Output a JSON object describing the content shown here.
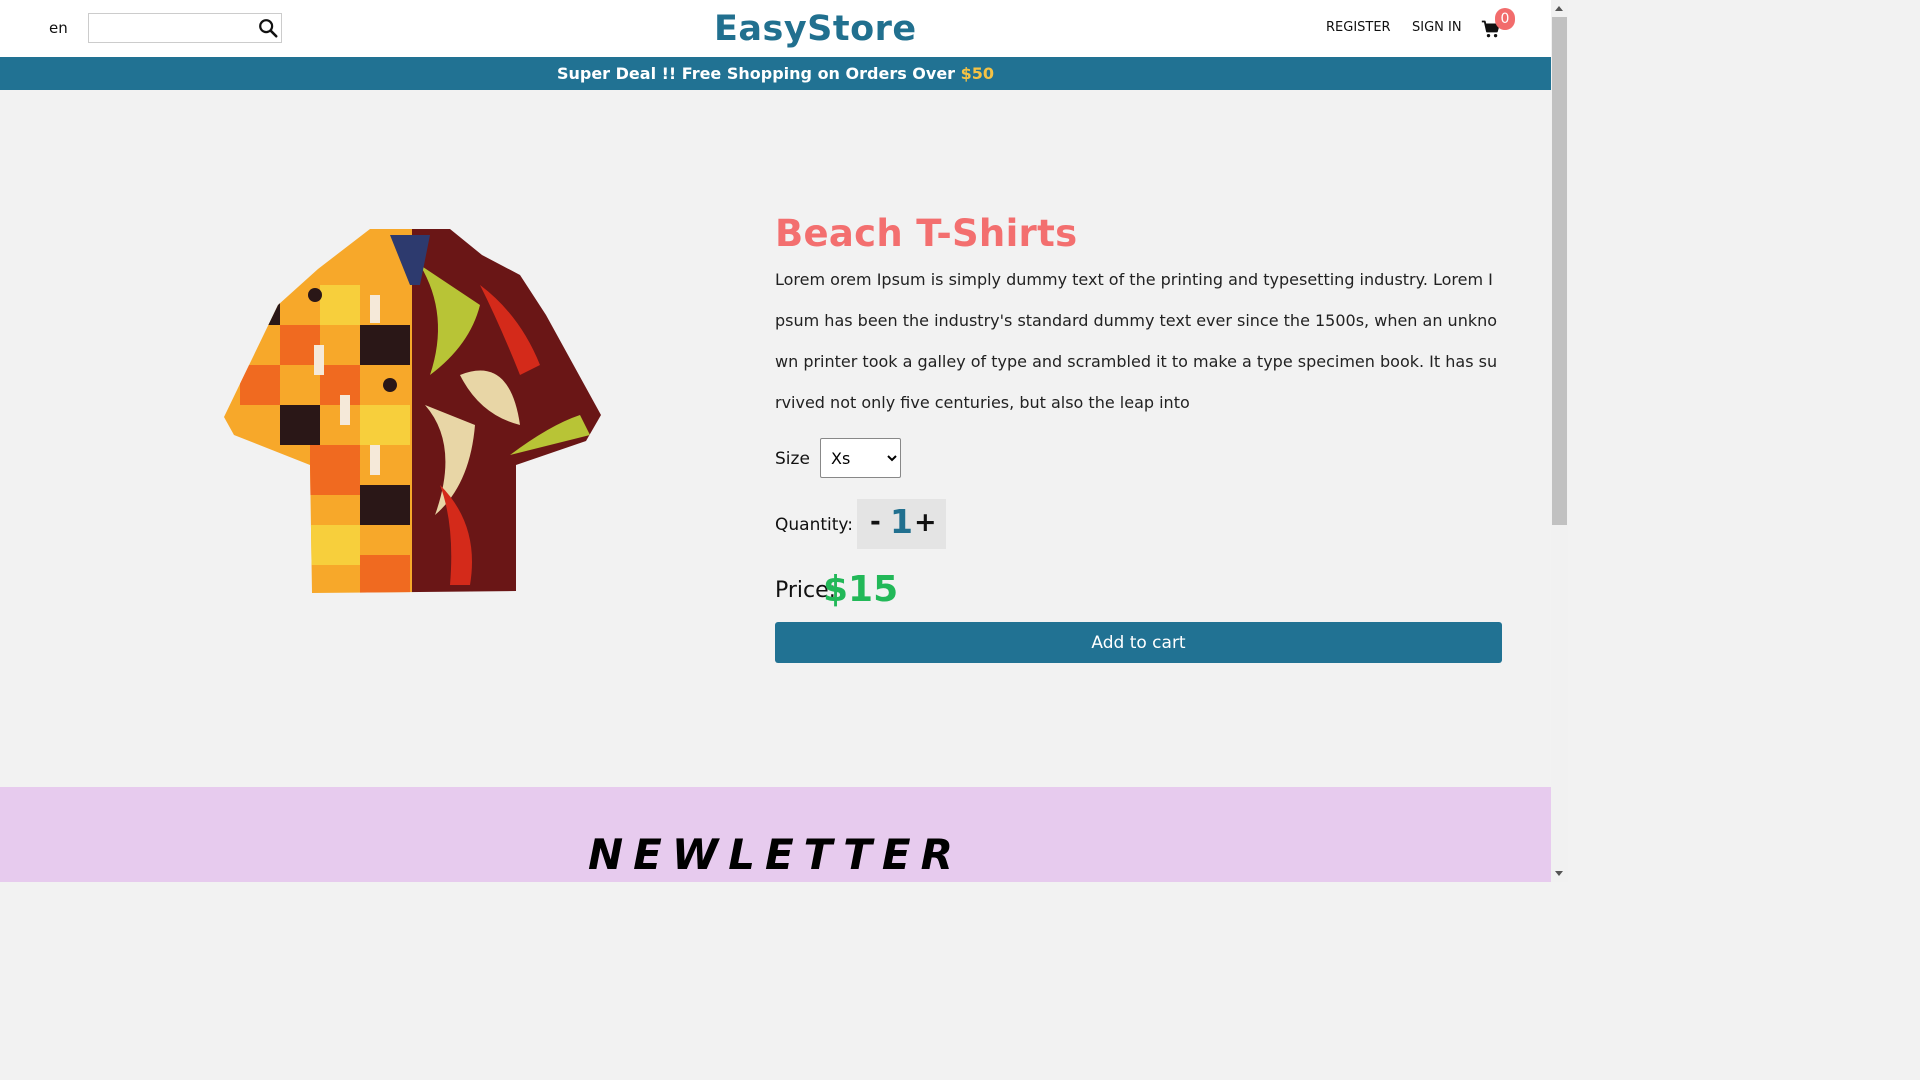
{
  "header": {
    "language": "en",
    "search": {
      "value": "",
      "placeholder": ""
    },
    "logo": "EasyStore",
    "register_label": "REGISTER",
    "signin_label": "SIGN IN",
    "cart_count": "0"
  },
  "promo": {
    "text": "Super Deal !! Free Shopping on Orders Over ",
    "amount": "$50"
  },
  "product": {
    "title": "Beach T-Shirts",
    "description": "Lorem orem Ipsum is simply dummy text of the printing and typesetting industry. Lorem Ipsum has been the industry's standard dummy text ever since the 1500s, when an unknown printer took a galley of type and scrambled it to make a type specimen book. It has survived not only five centuries, but also the leap into",
    "size_label": "Size",
    "size_options": [
      "Xs"
    ],
    "size_selected": "Xs",
    "quantity_label": "Quantity:",
    "quantity_minus": "-",
    "quantity": "1",
    "quantity_plus": "+",
    "price_label": "Price:",
    "price": "$15",
    "add_to_cart_label": "Add to cart"
  },
  "newsletter": {
    "title": "NEWLETTER"
  },
  "colors": {
    "brand": "#21708f",
    "title": "#f36f6f",
    "price": "#22b858",
    "promo_amount": "#f5c244",
    "newsletter_bg": "#e7cbee"
  },
  "icons": [
    "search-icon",
    "cart-icon",
    "shirt-image"
  ]
}
